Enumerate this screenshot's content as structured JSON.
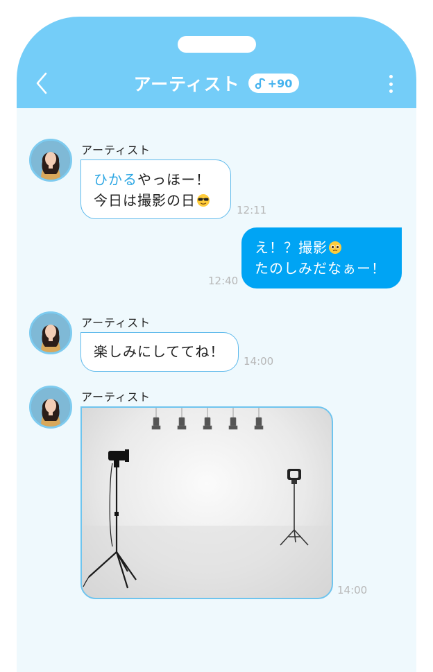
{
  "header": {
    "title": "アーティスト",
    "badge": "+90",
    "back_icon": "chevron-left-icon",
    "menu_icon": "more-vertical-icon",
    "badge_icon": "music-note-icon"
  },
  "colors": {
    "header_bg": "#74cdf8",
    "chat_bg": "#eff9fd",
    "outgoing_bubble": "#00a4f4",
    "incoming_border": "#5db9eb",
    "highlight_name": "#2ea7e3"
  },
  "messages": [
    {
      "sender": "アーティスト",
      "name_highlight": "ひかる",
      "line1_rest": "やっほー！",
      "line2": "今日は撮影の日",
      "emoji": "sunglasses-emoji",
      "time": "12:11"
    },
    {
      "line1": "え！？撮影",
      "emoji": "pleading-face-emoji",
      "line2": "たのしみだなぁー！",
      "time": "12:40"
    },
    {
      "sender": "アーティスト",
      "text": "楽しみにしててね！",
      "time": "14:00"
    },
    {
      "sender": "アーティスト",
      "image": "photo-studio-image",
      "time": "14:00"
    }
  ]
}
